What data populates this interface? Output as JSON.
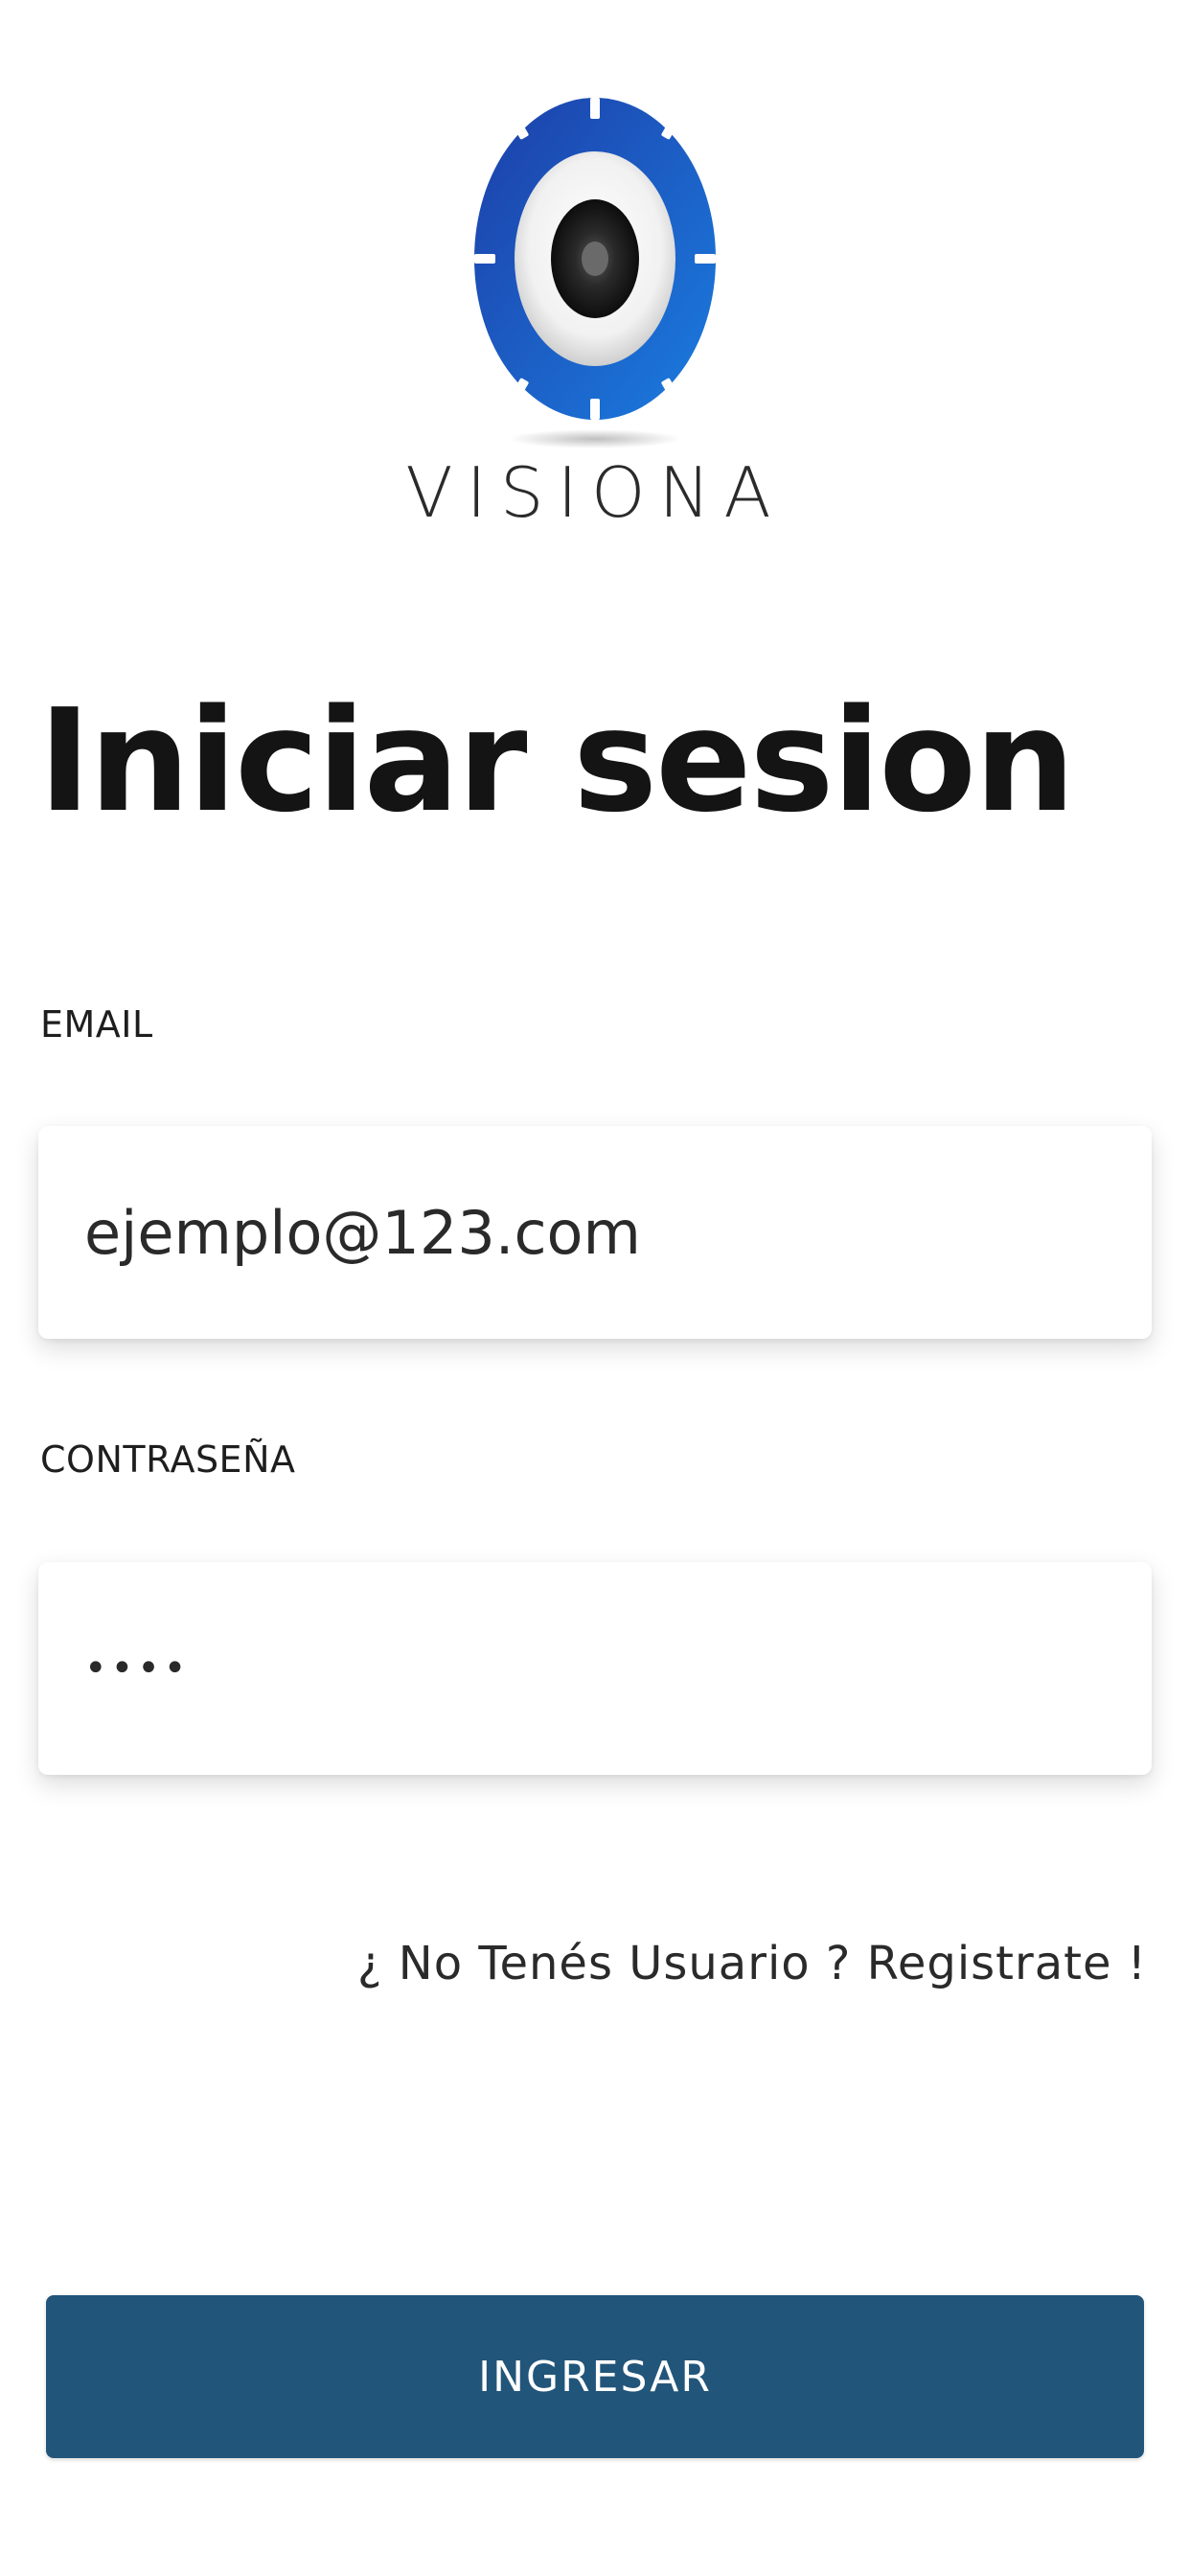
{
  "brand": {
    "name": "VISIONA",
    "logo_icon": "eye-gear-icon",
    "colors": {
      "primary": "#1f4fb8",
      "secondary": "#1a7ad8"
    }
  },
  "page": {
    "title": "Iniciar sesion"
  },
  "form": {
    "email_label": "EMAIL",
    "email_value": "ejemplo@123.com",
    "password_label": "CONTRASEÑA",
    "password_value": "••••",
    "register_link": "¿ No Tenés Usuario ? Registrate !",
    "submit_label": "INGRESAR",
    "submit_color": "#22557a"
  }
}
